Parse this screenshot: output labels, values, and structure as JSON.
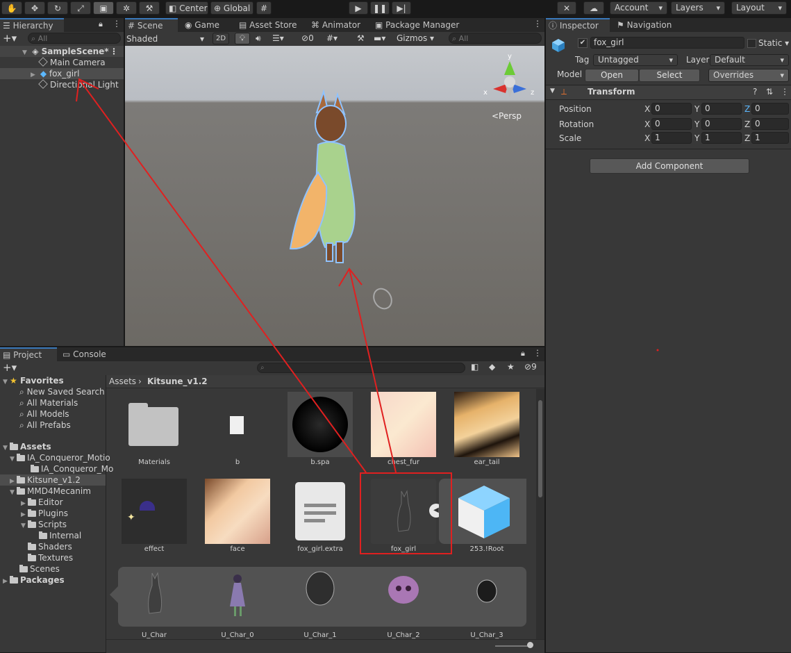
{
  "toolbar": {
    "pivot": "Center",
    "space": "Global",
    "account": "Account",
    "layers": "Layers",
    "layout": "Layout"
  },
  "hierarchy": {
    "tab": "Hierarchy",
    "search_placeholder": "All",
    "scene": "SampleScene*",
    "items": [
      "Main Camera",
      "fox_girl",
      "Directional Light"
    ]
  },
  "scene_view": {
    "tabs": [
      "Scene",
      "Game",
      "Asset Store",
      "Animator",
      "Package Manager"
    ],
    "shading": "Shaded",
    "mode_2d": "2D",
    "hidden_count": "0",
    "gizmos": "Gizmos",
    "search_placeholder": "All",
    "persp": "<Persp",
    "axis_x": "x",
    "axis_y": "y",
    "axis_z": "z"
  },
  "inspector": {
    "tabs": [
      "Inspector",
      "Navigation"
    ],
    "object_name": "fox_girl",
    "static_label": "Static",
    "tag_label": "Tag",
    "tag_value": "Untagged",
    "layer_label": "Layer",
    "layer_value": "Default",
    "model_label": "Model",
    "open": "Open",
    "select": "Select",
    "overrides": "Overrides",
    "transform_title": "Transform",
    "position_label": "Position",
    "rotation_label": "Rotation",
    "scale_label": "Scale",
    "axis_labels": [
      "X",
      "Y",
      "Z"
    ],
    "position": [
      "0",
      "0",
      "0"
    ],
    "rotation": [
      "0",
      "0",
      "0"
    ],
    "scale": [
      "1",
      "1",
      "1"
    ],
    "add_component": "Add Component"
  },
  "project": {
    "tabs": [
      "Project",
      "Console"
    ],
    "hidden_count": "9",
    "breadcrumb": [
      "Assets",
      "Kitsune_v1.2"
    ],
    "favorites_label": "Favorites",
    "favorites": [
      "New Saved Search",
      "All Materials",
      "All Models",
      "All Prefabs"
    ],
    "assets_label": "Assets",
    "tree": [
      {
        "label": "IA_Conqueror_Motio",
        "indent": 1
      },
      {
        "label": "IA_Conqueror_Mo",
        "indent": 2
      },
      {
        "label": "Kitsune_v1.2",
        "indent": 1
      },
      {
        "label": "MMD4Mecanim",
        "indent": 1
      },
      {
        "label": "Editor",
        "indent": 2
      },
      {
        "label": "Plugins",
        "indent": 2
      },
      {
        "label": "Scripts",
        "indent": 2
      },
      {
        "label": "Internal",
        "indent": 3
      },
      {
        "label": "Shaders",
        "indent": 2
      },
      {
        "label": "Textures",
        "indent": 2
      },
      {
        "label": "Scenes",
        "indent": 1
      }
    ],
    "packages_label": "Packages",
    "assets_row1": [
      "Materials",
      "b",
      "b.spa",
      "chest_fur",
      "ear_tail"
    ],
    "assets_row2": [
      "effect",
      "face",
      "fox_girl.extra",
      "fox_girl",
      "253.!Root"
    ],
    "assets_row3": [
      "U_Char",
      "U_Char_0",
      "U_Char_1",
      "U_Char_2",
      "U_Char_3"
    ]
  },
  "colors": {
    "accent": "#3a79bb",
    "annotation": "#e02020"
  }
}
